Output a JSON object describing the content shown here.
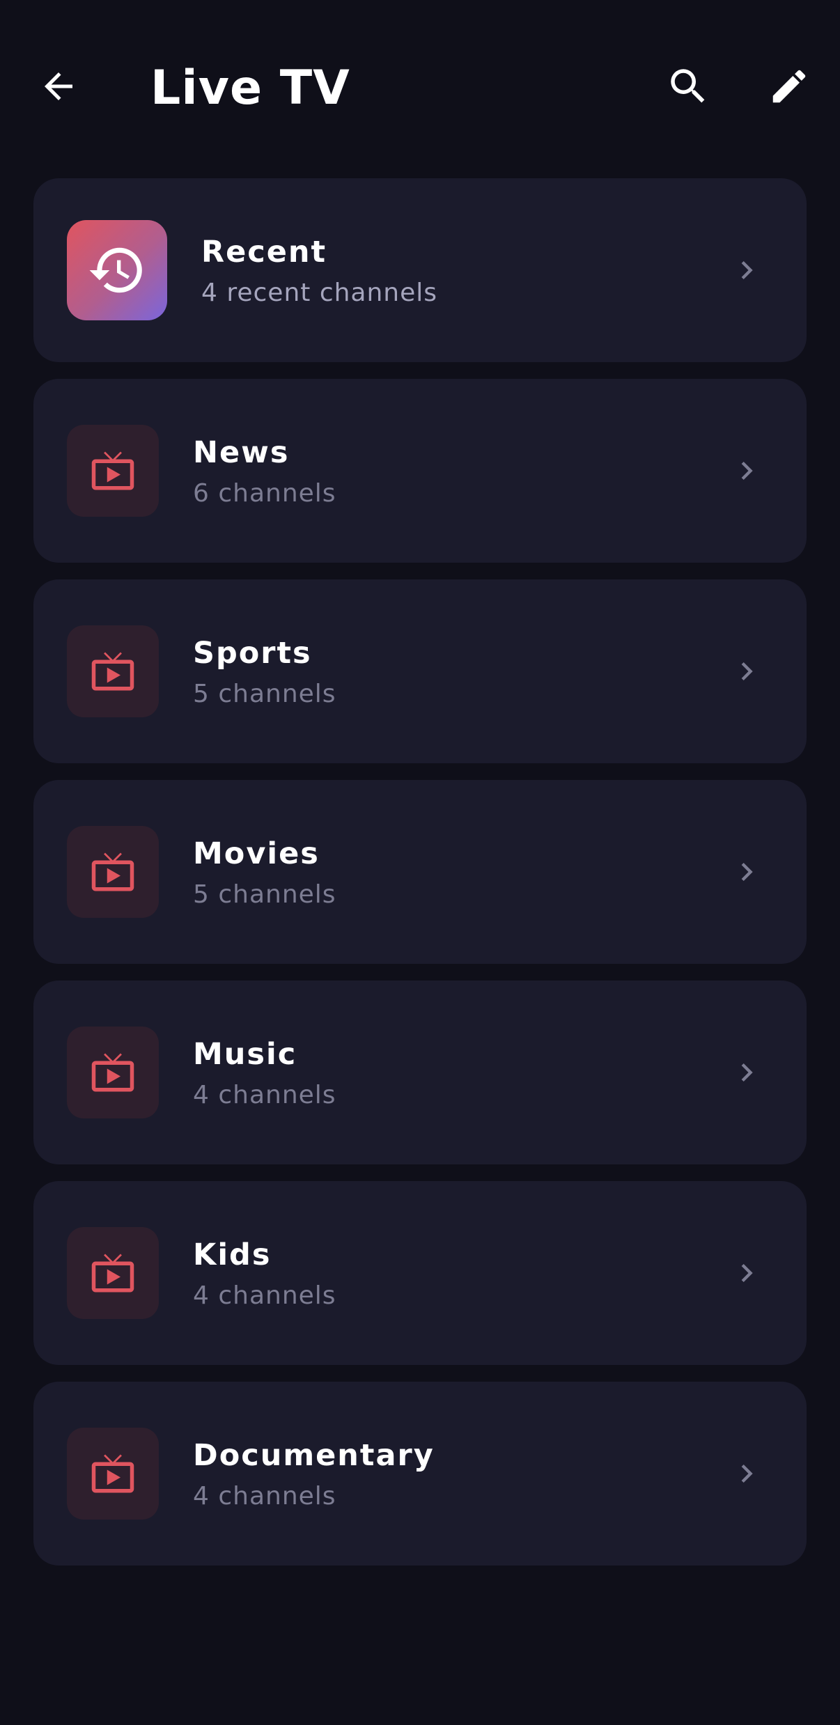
{
  "header": {
    "title": "Live TV",
    "back_icon": "arrow-left-icon",
    "search_icon": "search-icon",
    "edit_icon": "pencil-icon"
  },
  "recent": {
    "title": "Recent",
    "subtitle": "4 recent channels",
    "icon": "history-icon"
  },
  "categories": [
    {
      "title": "News",
      "subtitle": "6 channels",
      "icon": "tv-icon"
    },
    {
      "title": "Sports",
      "subtitle": "5 channels",
      "icon": "tv-icon"
    },
    {
      "title": "Movies",
      "subtitle": "5 channels",
      "icon": "tv-icon"
    },
    {
      "title": "Music",
      "subtitle": "4 channels",
      "icon": "tv-icon"
    },
    {
      "title": "Kids",
      "subtitle": "4 channels",
      "icon": "tv-icon"
    },
    {
      "title": "Documentary",
      "subtitle": "4 channels",
      "icon": "tv-icon"
    }
  ],
  "colors": {
    "background": "#0f0f19",
    "card": "#1b1b2c",
    "accent": "#e0555f",
    "accent_secondary": "#7a66dc",
    "icon_tile": "#2e1f2d",
    "subtitle": "#7d7d93"
  }
}
